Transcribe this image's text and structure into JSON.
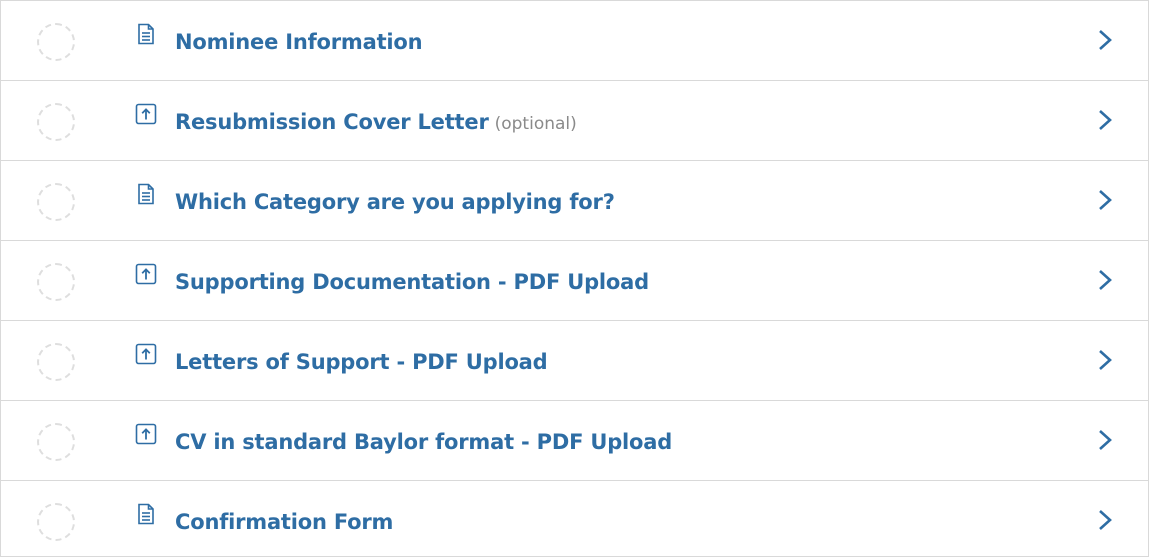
{
  "tasks": [
    {
      "name": "nominee-information",
      "title": "Nominee Information",
      "note": "",
      "icon": "document-icon"
    },
    {
      "name": "resubmission-cover-letter",
      "title": "Resubmission Cover Letter",
      "note": "(optional)",
      "icon": "upload-icon"
    },
    {
      "name": "which-category",
      "title": "Which Category are you applying for?",
      "note": "",
      "icon": "document-icon"
    },
    {
      "name": "supporting-documentation",
      "title": "Supporting Documentation - PDF Upload",
      "note": "",
      "icon": "upload-icon"
    },
    {
      "name": "letters-of-support",
      "title": "Letters of Support - PDF Upload",
      "note": "",
      "icon": "upload-icon"
    },
    {
      "name": "cv-standard-baylor-format",
      "title": "CV in standard Baylor format - PDF Upload",
      "note": "",
      "icon": "upload-icon"
    },
    {
      "name": "confirmation-form",
      "title": "Confirmation Form",
      "note": "",
      "icon": "document-icon"
    }
  ],
  "colors": {
    "title": "#2e6da4",
    "note": "#8a8a8a",
    "border": "#d9d9d9",
    "status_ring": "#dedede",
    "icon": "#2e6da4"
  }
}
